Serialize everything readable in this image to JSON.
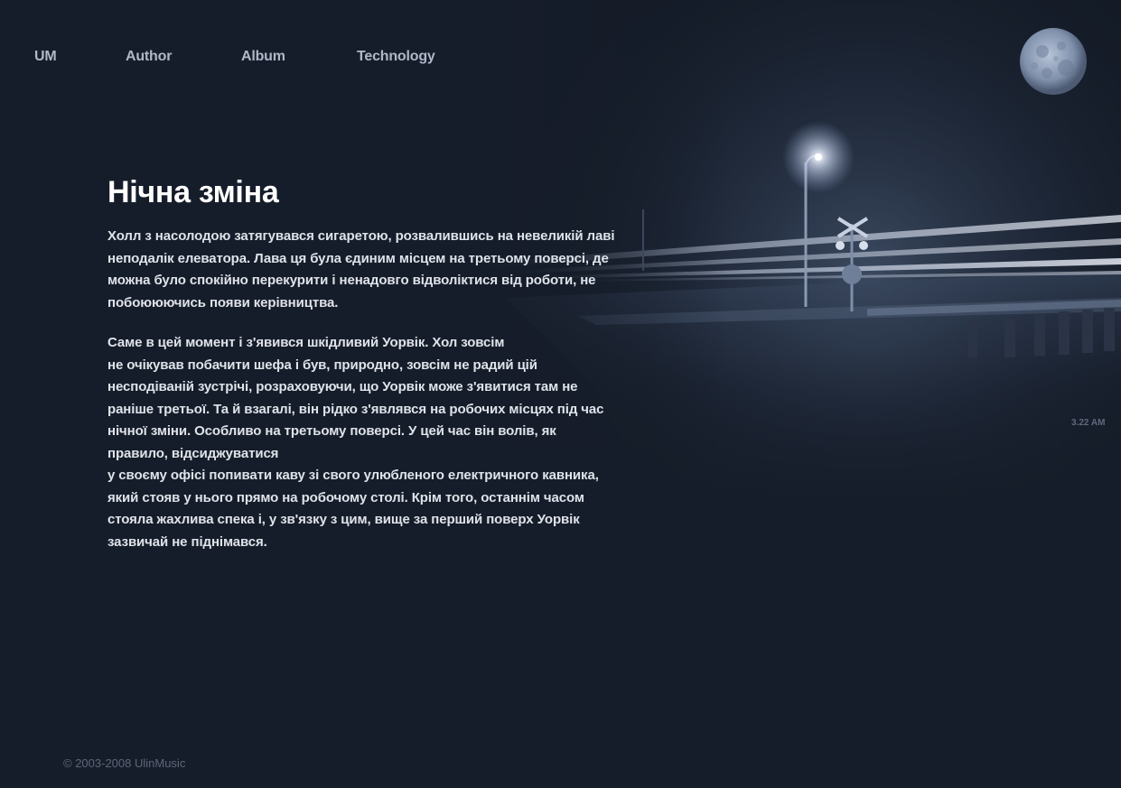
{
  "nav": {
    "items": [
      {
        "label": "UM"
      },
      {
        "label": "Author"
      },
      {
        "label": "Album"
      },
      {
        "label": "Technology"
      }
    ]
  },
  "photo": {
    "timestamp": "3.22 AM"
  },
  "article": {
    "title": "Нічна зміна",
    "paragraphs": [
      "Холл з насолодою затягувався сигаретою, розвалившись на невеликій лаві\nнеподалік елеватора. Лава ця була єдиним місцем на третьому поверсі, де\nможна було спокійно перекурити і ненадовго відволіктися від роботи, не\nпобоююючись появи керівництва.",
      "Саме в цей момент і з'явився шкідливий Уорвік. Хол зовсім\nне очікував побачити шефа і був, природно, зовсім не радий цій\nнесподіваній зустрічі, розраховуючи, що Уорвік може з'явитися там не\nраніше третьої. Та й взагалі, він рідко з'являвся на робочих місцях під час\nнічної зміни. Особливо на третьому поверсі. У цей час він волів, як\nправило, відсиджуватися\nу своєму офісі попивати каву зі свого улюбленого електричного кавника,\nякий стояв у нього прямо на робочому столі. Крім того, останнім часом\nстояла жахлива спека і, у зв'язку з цим, вище за перший поверх Уорвік\nзазвичай не піднімався."
    ]
  },
  "footer": {
    "copyright": "© 2003-2008 UlinMusic"
  },
  "colors": {
    "background": "#161d2a",
    "nav_text": "#aeb8c8",
    "title": "#ffffff",
    "body_text": "#dfe3ea",
    "footer_text": "#5d6778"
  },
  "icons": {
    "moon": "moon-icon"
  }
}
